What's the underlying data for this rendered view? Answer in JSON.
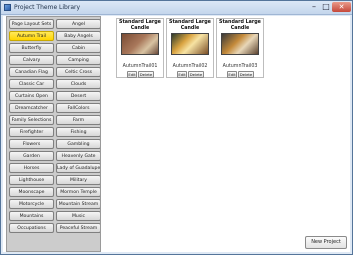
{
  "window": {
    "title": "Project Theme Library",
    "minimize_glyph": "–",
    "maximize_glyph": "□",
    "close_glyph": "✕"
  },
  "sidebar": {
    "selected": "Autumn Trail",
    "themes": [
      "Page Layout Sets",
      "Angel",
      "Autumn Trail",
      "Baby Angels",
      "Butterfly",
      "Cabin",
      "Calvary",
      "Camping",
      "Canadian Flag",
      "Celtic Cross",
      "Classic Car",
      "Clouds",
      "Curtains Open",
      "Desert",
      "Dreamcatcher",
      "FallColors",
      "Family Selections",
      "Farm",
      "Firefighter",
      "Fishing",
      "Flowers",
      "Gambling",
      "Garden",
      "Heavenly Gate",
      "Horses",
      "Lady of Guadalupe",
      "Lighthouse",
      "Military",
      "Moonscape",
      "Mormon Temple",
      "Motorcycle",
      "Mountain Stream",
      "Mountains",
      "Music",
      "Occupations",
      "Peaceful Stream"
    ]
  },
  "projects": [
    {
      "title": "Standard Large Candle",
      "name": "AutumnTrail01",
      "edit_label": "Edit",
      "delete_label": "Delete"
    },
    {
      "title": "Standard Large Candle",
      "name": "AutumnTrail02",
      "edit_label": "Edit",
      "delete_label": "Delete"
    },
    {
      "title": "Standard Large Candle",
      "name": "AutumnTrail03",
      "edit_label": "Edit",
      "delete_label": "Delete"
    }
  ],
  "actions": {
    "new_project_label": "New Project"
  }
}
